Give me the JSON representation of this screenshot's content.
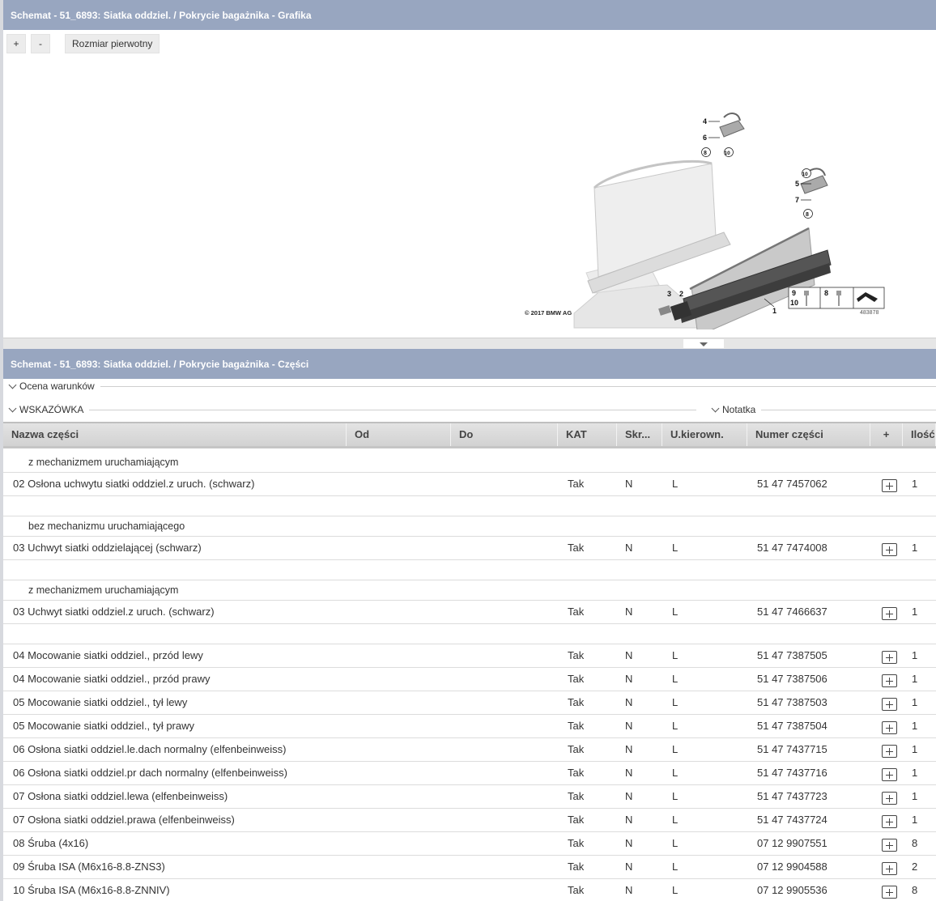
{
  "graphic_panel": {
    "title": "Schemat - 51_6893: Siatka oddziel. / Pokrycie bagażnika - Grafika",
    "zoom_in_label": "+",
    "zoom_out_label": "-",
    "reset_label": "Rozmiar pierwotny"
  },
  "diagram": {
    "callouts": [
      "1",
      "2",
      "3",
      "4",
      "5",
      "6",
      "7",
      "8",
      "9",
      "10"
    ],
    "legend_numbers": [
      "9",
      "10",
      "8"
    ],
    "copyright": "© 2017 BMW AG",
    "image_id": "483878"
  },
  "parts_panel": {
    "title": "Schemat - 51_6893: Siatka oddziel. / Pokrycie bagażnika - Części",
    "conditions_label": "Ocena warunków",
    "hint_label": "WSKAZÓWKA",
    "note_label": "Notatka"
  },
  "table": {
    "headers": {
      "name": "Nazwa części",
      "from": "Od",
      "to": "Do",
      "kat": "KAT",
      "skr": "Skr...",
      "steering": "U.kierown.",
      "number": "Numer części",
      "plus": "+",
      "qty": "Ilość"
    },
    "rows": [
      {
        "type": "note",
        "text": "z mechanizmem uruchamiającym"
      },
      {
        "type": "part",
        "name": "02 Osłona uchwytu siatki oddziel.z uruch. (schwarz)",
        "kat": "Tak",
        "skr": "N",
        "steering": "L",
        "number": "51 47 7457062",
        "qty": "1"
      },
      {
        "type": "blank"
      },
      {
        "type": "note",
        "text": "bez mechanizmu uruchamiającego"
      },
      {
        "type": "part",
        "name": "03 Uchwyt siatki oddzielającej (schwarz)",
        "kat": "Tak",
        "skr": "N",
        "steering": "L",
        "number": "51 47 7474008",
        "qty": "1"
      },
      {
        "type": "blank"
      },
      {
        "type": "note",
        "text": "z mechanizmem uruchamiającym"
      },
      {
        "type": "part",
        "name": "03 Uchwyt siatki oddziel.z uruch. (schwarz)",
        "kat": "Tak",
        "skr": "N",
        "steering": "L",
        "number": "51 47 7466637",
        "qty": "1"
      },
      {
        "type": "blank"
      },
      {
        "type": "part",
        "name": "04 Mocowanie siatki oddziel., przód lewy",
        "kat": "Tak",
        "skr": "N",
        "steering": "L",
        "number": "51 47 7387505",
        "qty": "1"
      },
      {
        "type": "part",
        "name": "04 Mocowanie siatki oddziel., przód prawy",
        "kat": "Tak",
        "skr": "N",
        "steering": "L",
        "number": "51 47 7387506",
        "qty": "1"
      },
      {
        "type": "part",
        "name": "05 Mocowanie siatki oddziel., tył lewy",
        "kat": "Tak",
        "skr": "N",
        "steering": "L",
        "number": "51 47 7387503",
        "qty": "1"
      },
      {
        "type": "part",
        "name": "05 Mocowanie siatki oddziel., tył prawy",
        "kat": "Tak",
        "skr": "N",
        "steering": "L",
        "number": "51 47 7387504",
        "qty": "1"
      },
      {
        "type": "part",
        "name": "06 Osłona siatki oddziel.le.dach normalny (elfenbeinweiss)",
        "kat": "Tak",
        "skr": "N",
        "steering": "L",
        "number": "51 47 7437715",
        "qty": "1"
      },
      {
        "type": "part",
        "name": "06 Osłona siatki oddziel.pr dach normalny (elfenbeinweiss)",
        "kat": "Tak",
        "skr": "N",
        "steering": "L",
        "number": "51 47 7437716",
        "qty": "1"
      },
      {
        "type": "part",
        "name": "07 Osłona siatki oddziel.lewa (elfenbeinweiss)",
        "kat": "Tak",
        "skr": "N",
        "steering": "L",
        "number": "51 47 7437723",
        "qty": "1"
      },
      {
        "type": "part",
        "name": "07 Osłona siatki oddziel.prawa (elfenbeinweiss)",
        "kat": "Tak",
        "skr": "N",
        "steering": "L",
        "number": "51 47 7437724",
        "qty": "1"
      },
      {
        "type": "part",
        "name": "08 Śruba (4x16)",
        "kat": "Tak",
        "skr": "N",
        "steering": "L",
        "number": "07 12 9907551",
        "qty": "8"
      },
      {
        "type": "part",
        "name": "09 Śruba ISA (M6x16-8.8-ZNS3)",
        "kat": "Tak",
        "skr": "N",
        "steering": "L",
        "number": "07 12 9904588",
        "qty": "2"
      },
      {
        "type": "part",
        "name": "10 Śruba ISA (M6x16-8.8-ZNNIV)",
        "kat": "Tak",
        "skr": "N",
        "steering": "L",
        "number": "07 12 9905536",
        "qty": "8"
      }
    ]
  },
  "colors": {
    "header_bar": "#98a6c0",
    "table_header": "#d8d8d8"
  }
}
